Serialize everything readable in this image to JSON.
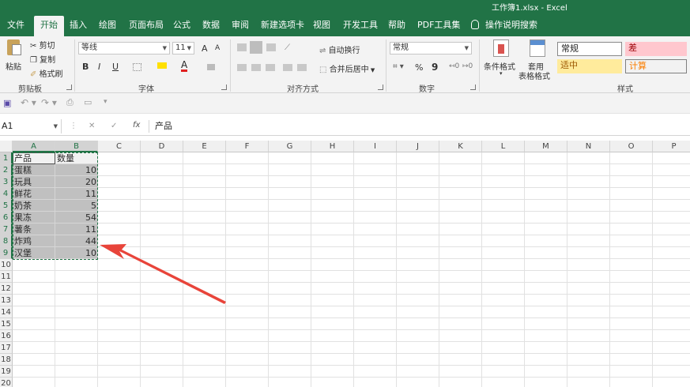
{
  "window": {
    "title": "工作簿1.xlsx  -  Excel"
  },
  "tabs": [
    {
      "label": "文件",
      "active": false
    },
    {
      "label": "开始",
      "active": true
    },
    {
      "label": "插入",
      "active": false
    },
    {
      "label": "绘图",
      "active": false
    },
    {
      "label": "页面布局",
      "active": false
    },
    {
      "label": "公式",
      "active": false
    },
    {
      "label": "数据",
      "active": false
    },
    {
      "label": "审阅",
      "active": false
    },
    {
      "label": "新建选项卡",
      "active": false
    },
    {
      "label": "视图",
      "active": false
    },
    {
      "label": "开发工具",
      "active": false
    },
    {
      "label": "帮助",
      "active": false
    },
    {
      "label": "PDF工具集",
      "active": false
    }
  ],
  "tell_me": {
    "label": "操作说明搜索",
    "icon": "lightbulb-icon"
  },
  "ribbon": {
    "clipboard": {
      "paste": "粘贴",
      "cut": "剪切",
      "copy": "复制",
      "format_painter": "格式刷",
      "group": "剪贴板"
    },
    "font": {
      "name": "等线",
      "size": "11",
      "bold": "B",
      "italic": "I",
      "underline": "U",
      "grow": "A",
      "shrink": "A",
      "font_color": "A",
      "group": "字体"
    },
    "alignment": {
      "wrap_text": "自动换行",
      "merge_center": "合并后居中",
      "group": "对齐方式"
    },
    "number": {
      "format": "常规",
      "percent": "%",
      "comma": "9",
      "group": "数字"
    },
    "styles": {
      "conditional": "条件格式",
      "table_format_1": "套用",
      "table_format_2": "表格格式",
      "normal": "常规",
      "bad": "差",
      "neutral": "适中",
      "calculation": "计算",
      "group": "样式"
    }
  },
  "formula_bar": {
    "name_box": "A1",
    "cancel": "✕",
    "enter": "✓",
    "fx": "fx",
    "content": "产品"
  },
  "sheet": {
    "columns": [
      "A",
      "B",
      "C",
      "D",
      "E",
      "F",
      "G",
      "H",
      "I",
      "J",
      "K",
      "L",
      "M",
      "N",
      "O",
      "P"
    ],
    "rows": [
      "1",
      "2",
      "3",
      "4",
      "5",
      "6",
      "7",
      "8",
      "9",
      "10",
      "11",
      "12",
      "13",
      "14",
      "15",
      "16",
      "17",
      "18",
      "19",
      "20"
    ],
    "header_row": [
      "产品",
      "数量"
    ],
    "data": [
      {
        "product": "蛋糕",
        "qty": "10"
      },
      {
        "product": "玩具",
        "qty": "20"
      },
      {
        "product": "鲜花",
        "qty": "11"
      },
      {
        "product": "奶茶",
        "qty": "5"
      },
      {
        "product": "果冻",
        "qty": "54"
      },
      {
        "product": "薯条",
        "qty": "11"
      },
      {
        "product": "炸鸡",
        "qty": "44"
      },
      {
        "product": "汉堡",
        "qty": "10"
      }
    ]
  },
  "colors": {
    "excel_green": "#217346",
    "arrow_red": "#e8443a",
    "bad_fill": "#ffc7ce",
    "neutral_fill": "#ffeb9c",
    "calc_text": "#fa7d00"
  }
}
